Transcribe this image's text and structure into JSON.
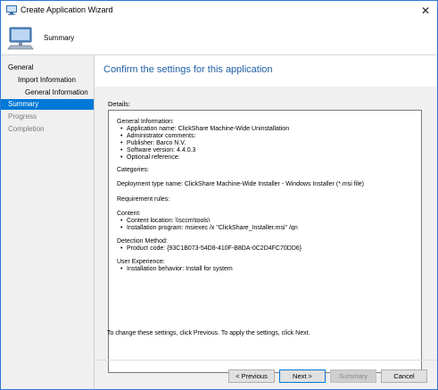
{
  "window": {
    "title": "Create Application Wizard",
    "close_glyph": "✕"
  },
  "header": {
    "title": "Summary"
  },
  "nav": {
    "items": [
      {
        "label": "General",
        "state": "normal"
      },
      {
        "label": "Import Information",
        "state": "normal"
      },
      {
        "label": "General Information",
        "state": "normal"
      },
      {
        "label": "Summary",
        "state": "selected"
      },
      {
        "label": "Progress",
        "state": "disabled"
      },
      {
        "label": "Completion",
        "state": "disabled"
      }
    ]
  },
  "main": {
    "heading": "Confirm the settings for this application",
    "details_label": "Details:",
    "details": {
      "general_header": "General Information:",
      "general_items": [
        "Application name: ClickShare Machine-Wide Uninstallation",
        "Administrator comments:",
        "Publisher: Barco N.V.",
        "Software version: 4.4.0.3",
        "Optional reference:"
      ],
      "categories": "Categories:",
      "deployment_type": "Deployment type name: ClickShare Machine-Wide Installer - Windows Installer (*.msi file)",
      "requirement_rules": "Requirement rules:",
      "content_header": "Content:",
      "content_items": [
        "Content location: \\\\sccm\\tools\\",
        "Installation program: msiexec /x \"ClickShare_Installer.msi\" /qn"
      ],
      "detection_header": "Detection Method:",
      "detection_items": [
        "Product code: {93C1B073-54D8-410F-B8DA-0C2D4FC70DD6}"
      ],
      "ux_header": "User Experience:",
      "ux_items": [
        "Installation behavior: Install for system"
      ]
    },
    "footer_note": "To change these settings, click Previous. To apply the settings, click Next."
  },
  "buttons": {
    "previous": "< Previous",
    "next": "Next >",
    "summary": "Summary",
    "cancel": "Cancel"
  },
  "colors": {
    "accent": "#0078d7",
    "heading": "#1f5fa6",
    "nav_bg": "#f0f0f0"
  }
}
